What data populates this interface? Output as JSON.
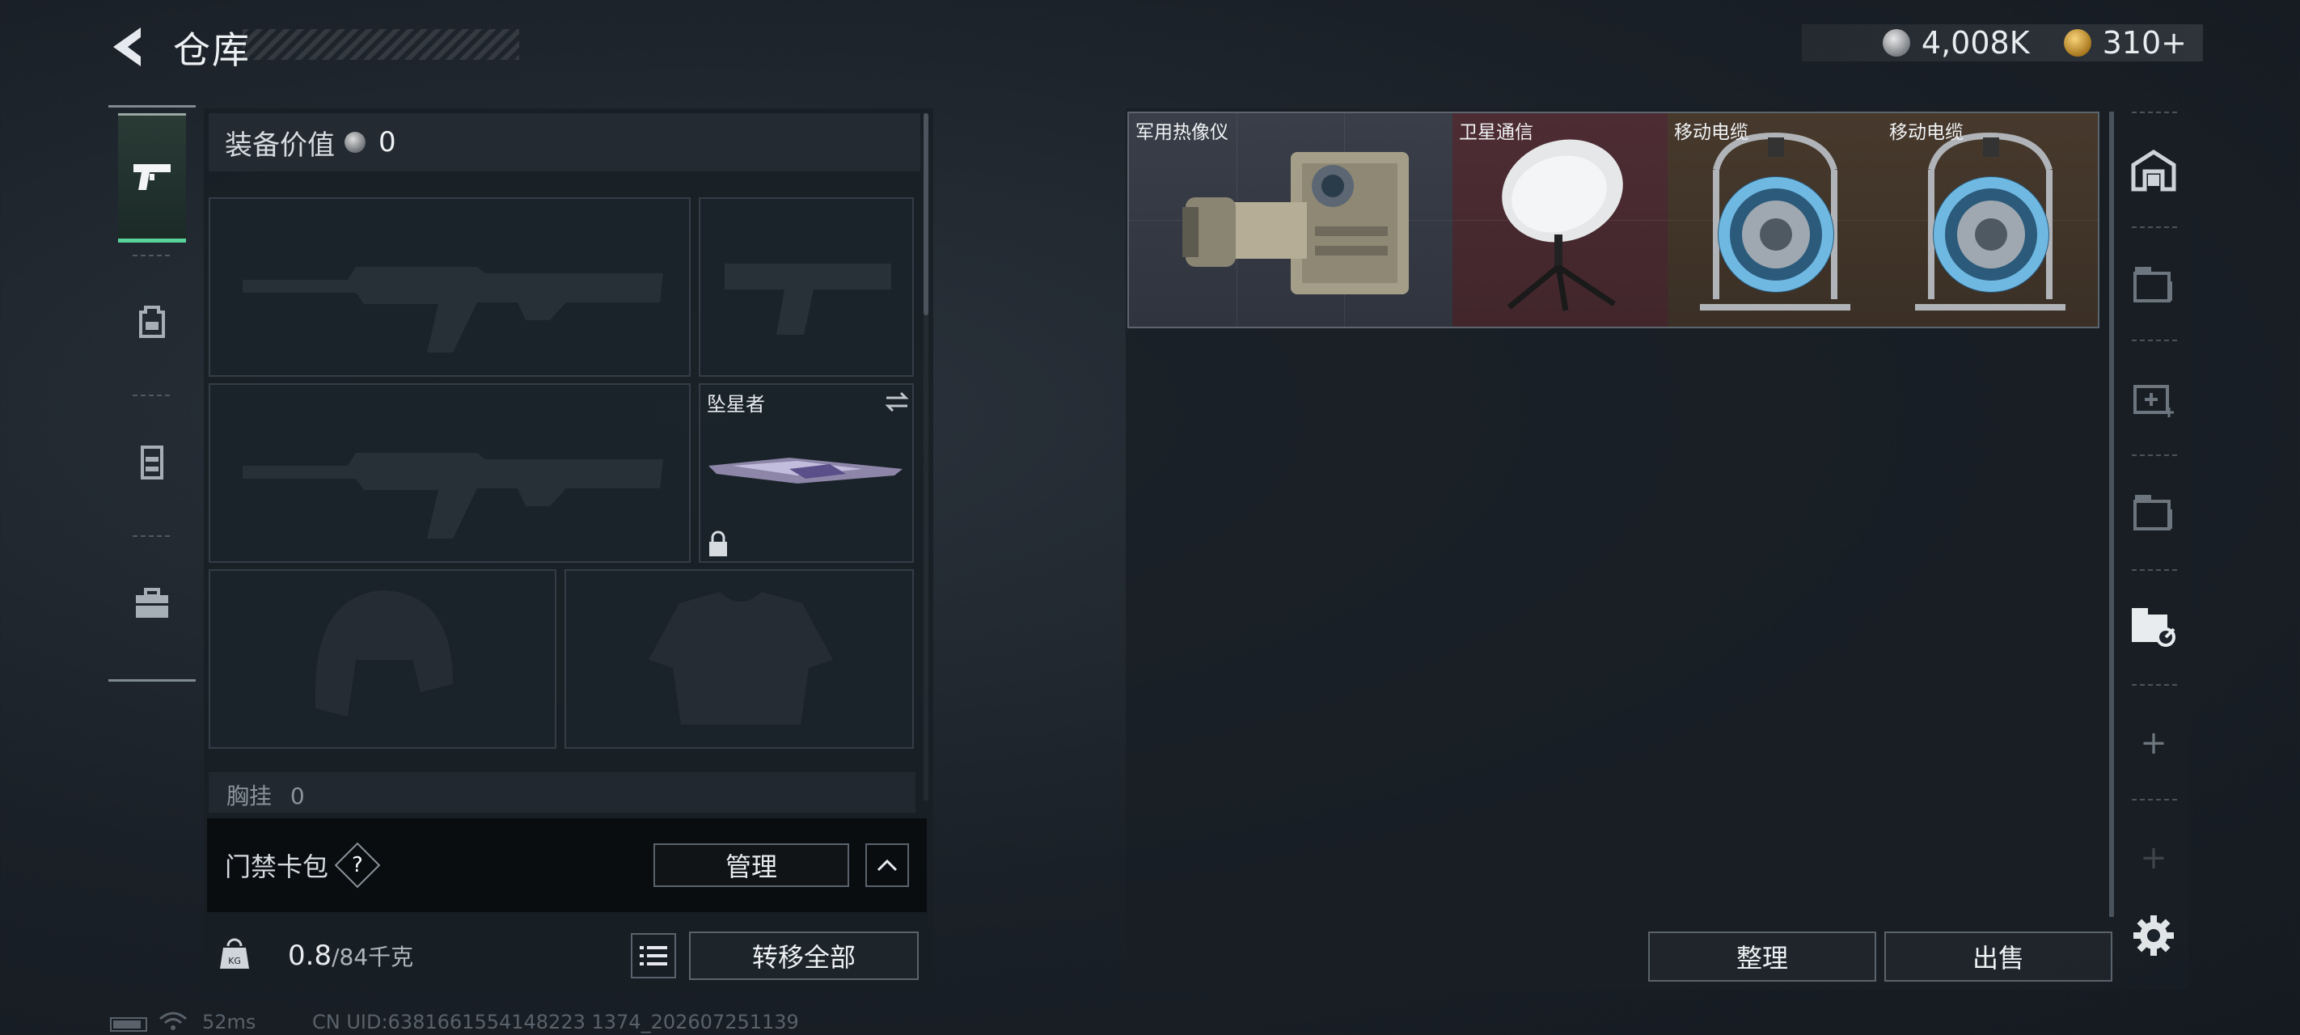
{
  "header": {
    "title": "仓库"
  },
  "currency": {
    "silver_value": "4,008K",
    "gold_value": "310+"
  },
  "tabs": [
    {
      "icon": "pistol-icon",
      "active": true
    },
    {
      "icon": "backpack-icon",
      "active": false
    },
    {
      "icon": "vest-icon",
      "active": false
    },
    {
      "icon": "briefcase-icon",
      "active": false
    }
  ],
  "equipment": {
    "label": "装备价值",
    "value": "0",
    "melee_name": "坠星者",
    "chest_label": "胸挂",
    "chest_count": "0"
  },
  "keycard": {
    "label": "门禁卡包",
    "help": "?",
    "manage_label": "管理"
  },
  "weight": {
    "current": "0.8",
    "max": "/84千克",
    "transfer_label": "转移全部"
  },
  "status": {
    "ping": "52ms",
    "uid": "CN UID:6381661554148223 1374_202607251139"
  },
  "stash": {
    "items": [
      {
        "name": "军用热像仪",
        "rarity": "grey"
      },
      {
        "name": "卫星通信",
        "rarity": "red"
      },
      {
        "name": "移动电缆",
        "rarity": "brown"
      },
      {
        "name": "移动电缆",
        "rarity": "brown"
      }
    ],
    "sort_label": "整理",
    "sell_label": "出售"
  },
  "colors": {
    "accent_green": "#58d39a",
    "rarity_grey": "#3a3e48",
    "rarity_red": "#4d2d33",
    "rarity_brown": "#47392c"
  }
}
